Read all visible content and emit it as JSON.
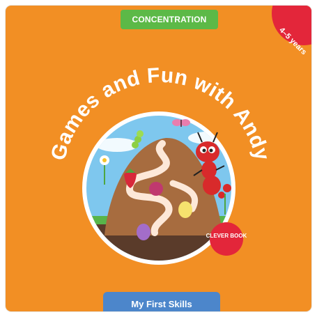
{
  "cover": {
    "category_label": "CONCENTRATION",
    "age_label": "4–5 years",
    "title": "Games and Fun with Andy",
    "publisher_logo_text": "CLEVER BOOK",
    "series_label": "My First Skills"
  },
  "colors": {
    "background": "#f28f24",
    "category_tab": "#5cb947",
    "age_badge": "#e3263a",
    "series_tab": "#4c86cb",
    "publisher_badge": "#e3263a",
    "scene_circle_border": "#ffffff",
    "sky": "#7ec7ee",
    "mound": "#a76c3f",
    "path": "#ffffff",
    "ant": "#d82a2b"
  },
  "icons": {
    "main_character": "ant-icon",
    "butterfly": "butterfly-icon",
    "caterpillar": "caterpillar-icon",
    "strawberry": "strawberry-icon",
    "raspberry": "raspberry-icon",
    "flower": "flower-icon"
  }
}
